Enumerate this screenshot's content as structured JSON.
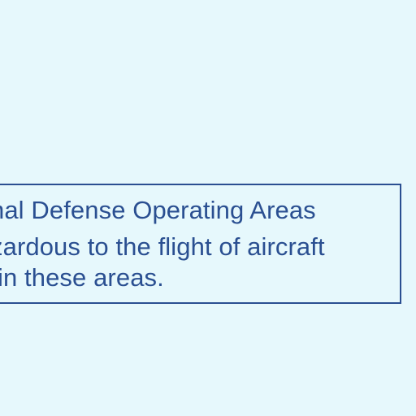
{
  "map": {
    "background_color": "#e6f8fc",
    "notice": {
      "border_color": "#2a4f91",
      "text_color": "#2a4f91",
      "lines": [
        "nal Defense Operating Areas",
        "zardous to the flight of aircraft",
        "in these areas."
      ]
    }
  }
}
